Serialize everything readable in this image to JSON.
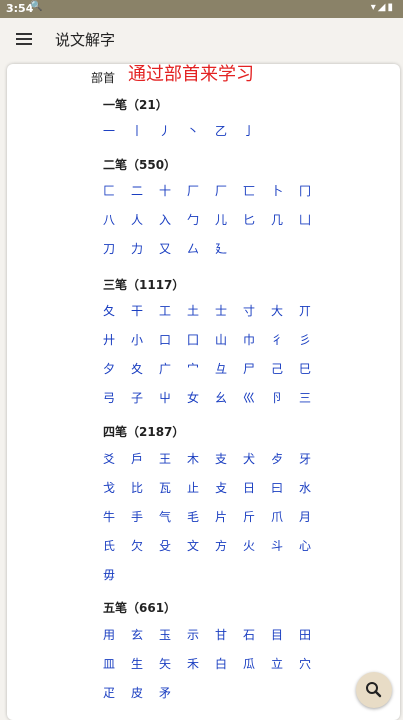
{
  "status": {
    "time": "3:54",
    "search_glyph": "🔍",
    "right_glyphs": "▾◢▮"
  },
  "appbar": {
    "title": "说文解字"
  },
  "page": {
    "bushou_label": "部首",
    "headline": "通过部首来学习"
  },
  "sections": [
    {
      "heading": "一笔（21）",
      "chars": [
        "一",
        "丨",
        "丿",
        "丶",
        "乙",
        "亅"
      ]
    },
    {
      "heading": "二笔（550）",
      "chars": [
        "匚",
        "二",
        "十",
        "厂",
        "厂",
        "匸",
        "卜",
        "冂",
        "八",
        "人",
        "入",
        "勹",
        "儿",
        "匕",
        "几",
        "凵",
        "刀",
        "力",
        "又",
        "厶",
        "廴"
      ]
    },
    {
      "heading": "三笔（1117）",
      "chars": [
        "夂",
        "干",
        "工",
        "土",
        "士",
        "寸",
        "大",
        "丌",
        "廾",
        "小",
        "口",
        "囗",
        "山",
        "巾",
        "彳",
        "彡",
        "夕",
        "夊",
        "广",
        "宀",
        "彑",
        "尸",
        "己",
        "巳",
        "弓",
        "子",
        "屮",
        "女",
        "幺",
        "巛",
        "卪",
        "三"
      ]
    },
    {
      "heading": "四笔（2187）",
      "chars": [
        "爻",
        "戶",
        "王",
        "木",
        "支",
        "犬",
        "歺",
        "牙",
        "戈",
        "比",
        "瓦",
        "止",
        "攴",
        "日",
        "曰",
        "水",
        "牛",
        "手",
        "气",
        "毛",
        "片",
        "斤",
        "爪",
        "月",
        "氏",
        "欠",
        "殳",
        "文",
        "方",
        "火",
        "斗",
        "心",
        "毋"
      ]
    },
    {
      "heading": "五笔（661）",
      "chars": [
        "用",
        "玄",
        "玉",
        "示",
        "甘",
        "石",
        "目",
        "田",
        "皿",
        "生",
        "矢",
        "禾",
        "白",
        "瓜",
        "立",
        "穴",
        "疋",
        "皮",
        "矛"
      ]
    }
  ],
  "fab": {
    "icon": "search-icon"
  },
  "colors": {
    "statusbar": "#8a8268",
    "headline": "#e32222",
    "link": "#1a3ec1",
    "fab": "#e8dcc6"
  }
}
